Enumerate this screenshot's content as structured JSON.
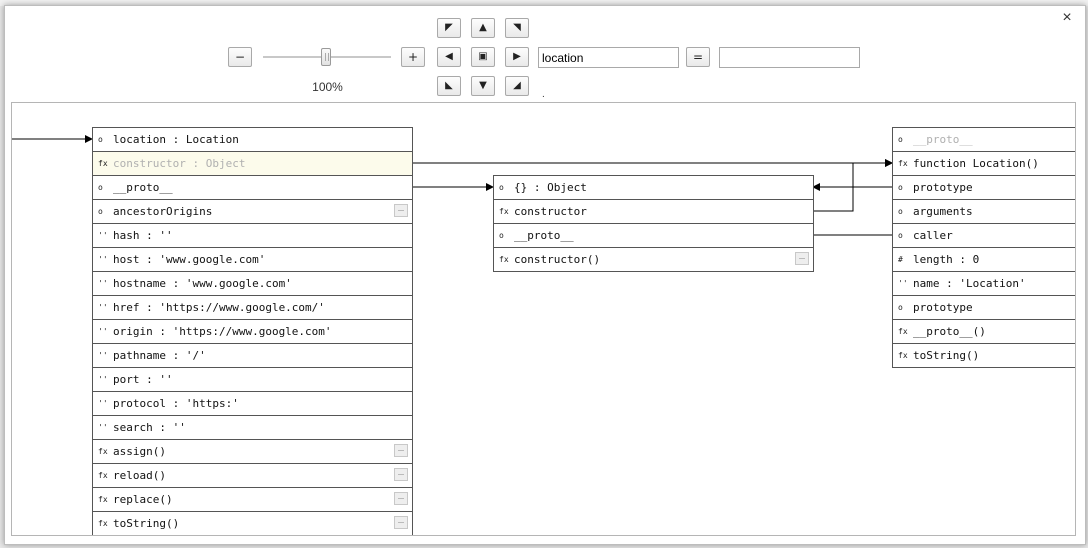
{
  "toolbar": {
    "zoom_out_label": "−",
    "zoom_in_label": "+",
    "zoom_level": "100%",
    "zoom_fraction": 0.5,
    "equals_label": "=",
    "search_value": "location",
    "search_placeholder": "",
    "result_value": "",
    "dot": ".",
    "nav": {
      "up_left": "◤",
      "up": "▲",
      "up_right": "◥",
      "left": "◀",
      "center": "▣",
      "right": "▶",
      "down_left": "◣",
      "down": "▼",
      "down_right": "◢"
    }
  },
  "close_label": "×",
  "panels": {
    "location": {
      "rows": [
        {
          "kind": "o",
          "label": "location : Location"
        },
        {
          "kind": "fx",
          "label": "constructor : Object"
        },
        {
          "kind": "o",
          "label": "__proto__"
        },
        {
          "kind": "o",
          "label": "ancestorOrigins"
        },
        {
          "kind": "''",
          "label": "hash : ''"
        },
        {
          "kind": "''",
          "label": "host : 'www.google.com'"
        },
        {
          "kind": "''",
          "label": "hostname : 'www.google.com'"
        },
        {
          "kind": "''",
          "label": "href : 'https://www.google.com/'"
        },
        {
          "kind": "''",
          "label": "origin : 'https://www.google.com'"
        },
        {
          "kind": "''",
          "label": "pathname : '/'"
        },
        {
          "kind": "''",
          "label": "port : ''"
        },
        {
          "kind": "''",
          "label": "protocol : 'https:'"
        },
        {
          "kind": "''",
          "label": "search : ''"
        },
        {
          "kind": "fx",
          "label": "assign()"
        },
        {
          "kind": "fx",
          "label": "reload()"
        },
        {
          "kind": "fx",
          "label": "replace()"
        },
        {
          "kind": "fx",
          "label": "toString()"
        }
      ]
    },
    "object": {
      "rows": [
        {
          "kind": "o",
          "label": "{} : Object"
        },
        {
          "kind": "fx",
          "label": "constructor"
        },
        {
          "kind": "o",
          "label": "__proto__"
        },
        {
          "kind": "fx",
          "label": "constructor()"
        }
      ]
    },
    "function": {
      "rows": [
        {
          "kind": "o",
          "label": "__proto__"
        },
        {
          "kind": "fx",
          "label": "function Location()"
        },
        {
          "kind": "o",
          "label": "prototype"
        },
        {
          "kind": "o",
          "label": "arguments"
        },
        {
          "kind": "o",
          "label": "caller"
        },
        {
          "kind": "#",
          "label": "length : 0"
        },
        {
          "kind": "''",
          "label": "name : 'Location'"
        },
        {
          "kind": "o",
          "label": "prototype"
        },
        {
          "kind": "fx",
          "label": "__proto__()"
        },
        {
          "kind": "fx",
          "label": "toString()"
        }
      ]
    }
  }
}
